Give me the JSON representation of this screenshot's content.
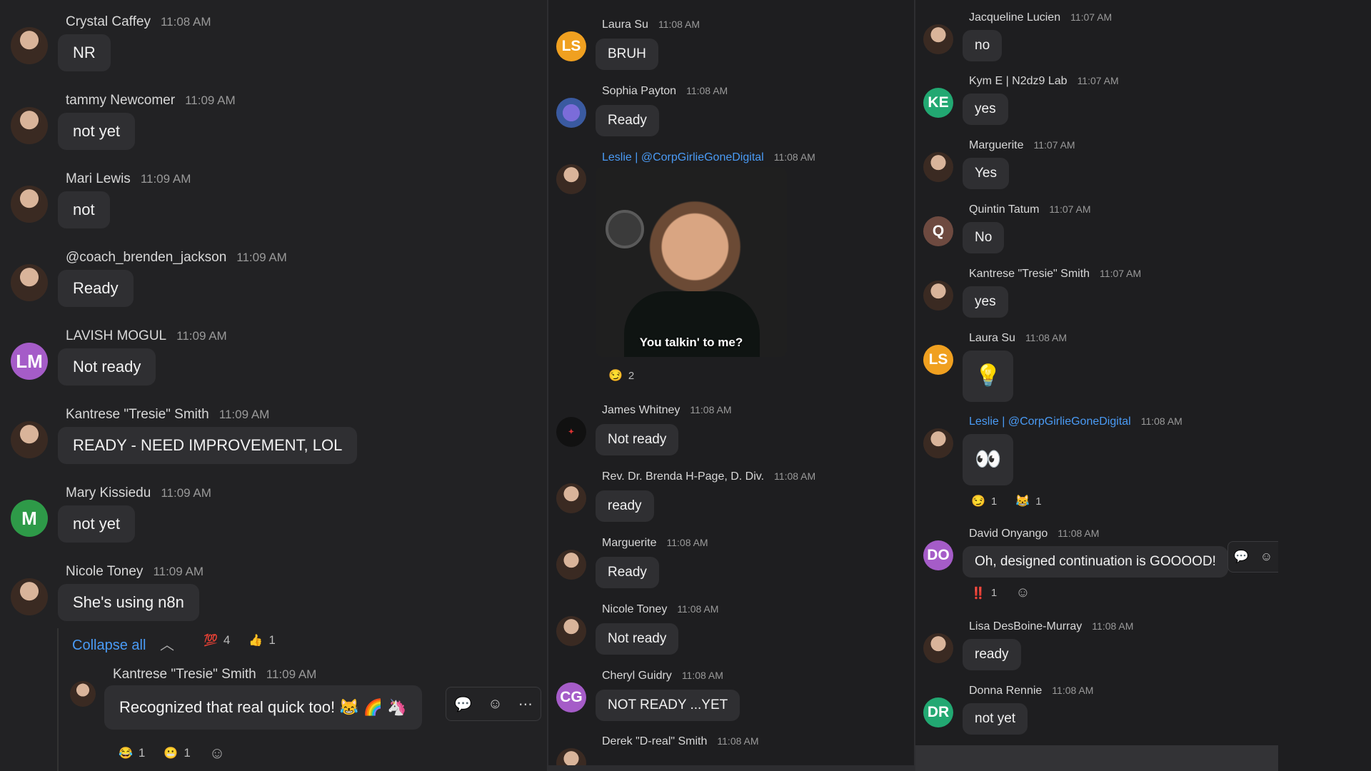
{
  "column1": {
    "messages": [
      {
        "name": "Crystal Caffey",
        "time": "11:08 AM",
        "text": "NR"
      },
      {
        "name": "tammy Newcomer",
        "time": "11:09 AM",
        "text": "not yet"
      },
      {
        "name": "Mari Lewis",
        "time": "11:09 AM",
        "text": "not"
      },
      {
        "name": "@coach_brenden_jackson",
        "time": "11:09 AM",
        "text": "Ready"
      },
      {
        "name": "LAVISH MOGUL",
        "time": "11:09 AM",
        "text": "Not ready",
        "initials": "LM",
        "color": "#a55cc8"
      },
      {
        "name": "Kantrese \"Tresie\" Smith",
        "time": "11:09 AM",
        "text": "READY - NEED IMPROVEMENT, LOL"
      },
      {
        "name": "Mary Kissiedu",
        "time": "11:09 AM",
        "text": "not yet",
        "initials": "M",
        "color": "#2e9a48"
      },
      {
        "name": "Nicole Toney",
        "time": "11:09 AM",
        "text": "She's using n8n"
      }
    ],
    "collapse_label": "Collapse all",
    "thread_reactions": [
      {
        "emoji": "💯",
        "count": "4"
      },
      {
        "emoji": "👍",
        "count": "1"
      }
    ],
    "reply": {
      "name": "Kantrese \"Tresie\" Smith",
      "time": "11:09 AM",
      "text": "Recognized that real quick too! 😹 🌈 🦄",
      "reactions": [
        {
          "emoji": "😂",
          "count": "1"
        },
        {
          "emoji": "😬",
          "count": "1"
        }
      ]
    }
  },
  "column2": {
    "messages": [
      {
        "name": "Laura Su",
        "time": "11:08 AM",
        "text": "BRUH",
        "initials": "LS",
        "color": "#f0a020"
      },
      {
        "name": "Sophia Payton",
        "time": "11:08 AM",
        "text": "Ready"
      },
      {
        "name": "Leslie | @CorpGirlieGoneDigital",
        "time": "11:08 AM",
        "gif_caption": "You talkin' to me?",
        "reaction": {
          "emoji": "😏",
          "count": "2"
        }
      },
      {
        "name": "James Whitney",
        "time": "11:08 AM",
        "text": "Not ready"
      },
      {
        "name": "Rev. Dr. Brenda H-Page, D. Div.",
        "time": "11:08 AM",
        "text": "ready"
      },
      {
        "name": "Marguerite",
        "time": "11:08 AM",
        "text": "Ready"
      },
      {
        "name": "Nicole Toney",
        "time": "11:08 AM",
        "text": "Not ready"
      },
      {
        "name": "Cheryl Guidry",
        "time": "11:08 AM",
        "text": "NOT READY ...YET",
        "initials": "CG",
        "color": "#a55cc8"
      },
      {
        "name": "Derek \"D-real\" Smith",
        "time": "11:08 AM"
      }
    ]
  },
  "column3": {
    "messages": [
      {
        "name": "Jacqueline Lucien",
        "time": "11:07 AM",
        "text": "no"
      },
      {
        "name": "Kym E | N2dz9 Lab",
        "time": "11:07 AM",
        "text": "yes",
        "initials": "KE",
        "color": "#22a872"
      },
      {
        "name": "Marguerite",
        "time": "11:07 AM",
        "text": "Yes"
      },
      {
        "name": "Quintin Tatum",
        "time": "11:07 AM",
        "text": "No",
        "initials": "Q",
        "color": "#6e4a40"
      },
      {
        "name": "Kantrese \"Tresie\" Smith",
        "time": "11:07 AM",
        "text": "yes"
      },
      {
        "name": "Laura Su",
        "time": "11:08 AM",
        "text": "💡",
        "initials": "LS",
        "color": "#f0a020"
      },
      {
        "name": "Leslie | @CorpGirlieGoneDigital",
        "time": "11:08 AM",
        "text": "👀",
        "reactions": [
          {
            "emoji": "😏",
            "count": "1"
          },
          {
            "emoji": "😹",
            "count": "1"
          }
        ]
      },
      {
        "name": "David Onyango",
        "time": "11:08 AM",
        "text": "Oh, designed continuation is GOOOOD!",
        "initials": "DO",
        "color": "#a55cc8",
        "reaction": {
          "emoji": "‼️",
          "count": "1"
        }
      },
      {
        "name": "Lisa DesBoine-Murray",
        "time": "11:08 AM",
        "text": "ready"
      },
      {
        "name": "Donna Rennie",
        "time": "11:08 AM",
        "text": "not yet",
        "initials": "DR",
        "color": "#22a872"
      }
    ]
  },
  "icons": [
    "reply-thread-icon",
    "add-reaction-icon",
    "more-icon",
    "chevron-up-icon"
  ]
}
